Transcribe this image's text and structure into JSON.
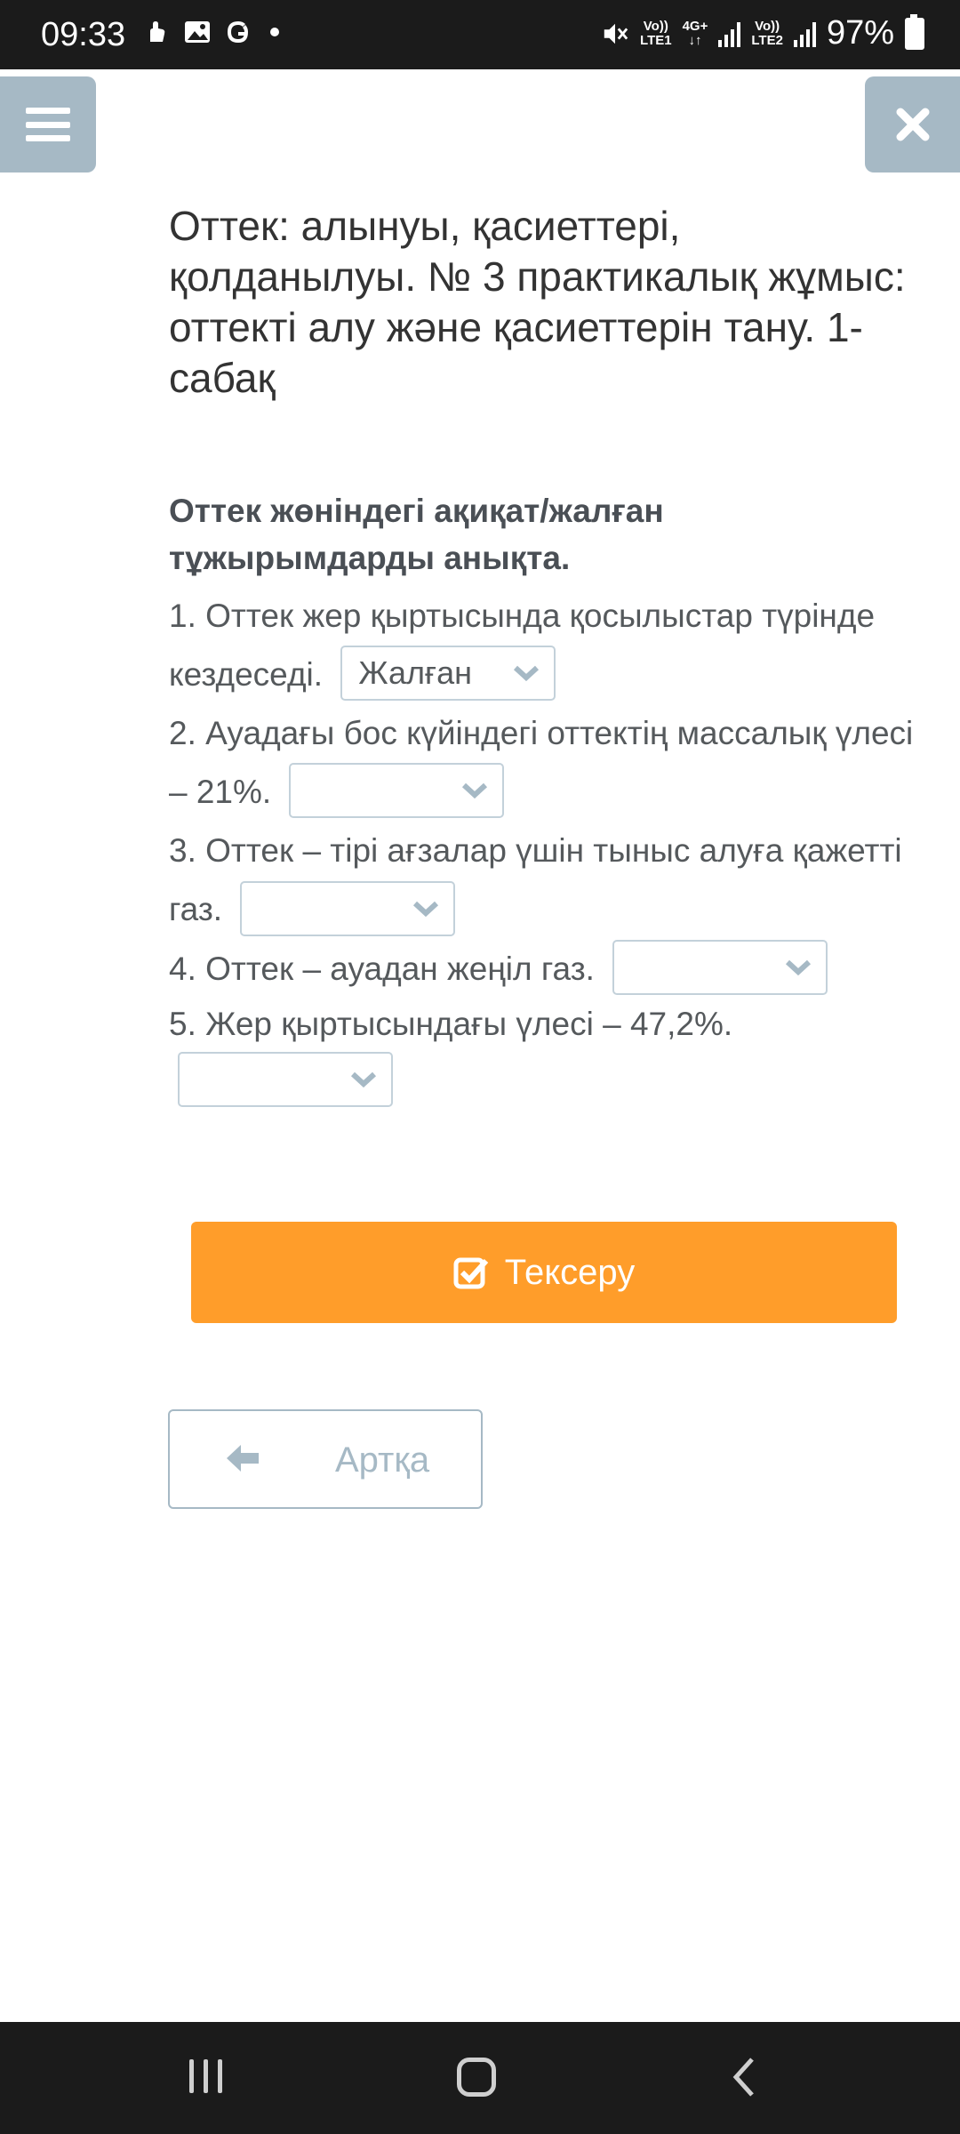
{
  "status_bar": {
    "time": "09:33",
    "network1_top": "Vo))",
    "network1_bottom": "LTE1",
    "network_type": "4G+",
    "network_type_arrows": "↓↑",
    "network2_top": "Vo))",
    "network2_bottom": "LTE2",
    "battery": "97%"
  },
  "title": "Оттек: алынуы, қасиеттері, қолданылуы. № 3 практикалық жұмыс: оттекті алу және қасиеттерін тану. 1-сабақ",
  "question": "Оттек жөніндегі ақиқат/жалған тұжырымдарды анықта.",
  "items": [
    {
      "text": "1. Оттек жер қыртысында қосылыстар түрінде кездеседі.",
      "selected": "Жалған"
    },
    {
      "text": "2. Ауадағы бос күйіндегі оттектің массалық үлесі – 21%.",
      "selected": ""
    },
    {
      "text": "3. Оттек – тірі ағзалар үшін тыныс алуға қажетті газ.",
      "selected": ""
    },
    {
      "text": "4. Оттек – ауадан жеңіл газ.",
      "selected": ""
    },
    {
      "text": "5. Жер қыртысындағы үлесі – 47,2%.",
      "selected": ""
    }
  ],
  "check_button": {
    "label": "Тексеру",
    "color": "#ff9d2a"
  },
  "back_button": {
    "label": "Артқа"
  },
  "colors": {
    "accent_gray": "#a6b9c5",
    "text": "#55595c"
  },
  "icons": [
    "hamburger-menu-icon",
    "close-icon",
    "chevron-down-icon",
    "check-square-icon",
    "arrow-left-icon"
  ]
}
